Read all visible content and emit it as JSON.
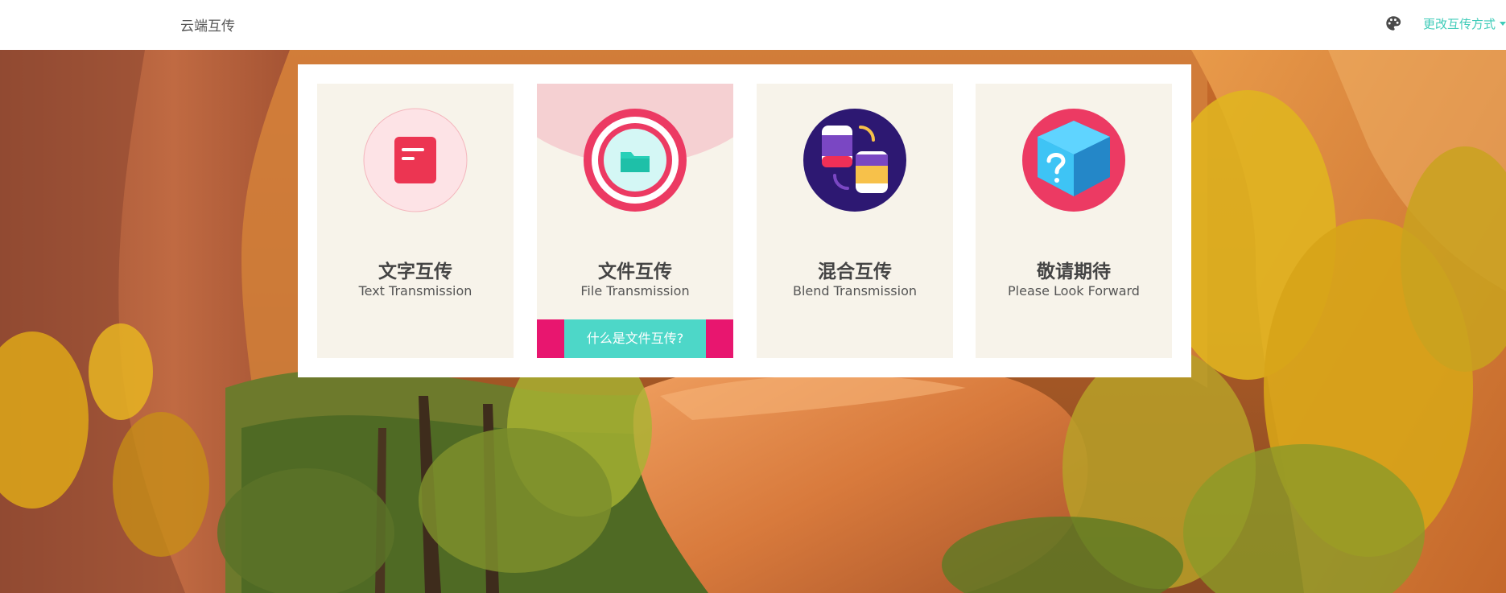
{
  "navbar": {
    "brand": "云端互传",
    "palette_icon": "palette-icon",
    "switch_label": "更改互传方式"
  },
  "cards": [
    {
      "title": "文字互传",
      "subtitle": "Text Transmission",
      "icon": "document-icon"
    },
    {
      "title": "文件互传",
      "subtitle": "File Transmission",
      "icon": "folder-icon",
      "button_label": "什么是文件互传?"
    },
    {
      "title": "混合互传",
      "subtitle": "Blend Transmission",
      "icon": "blend-icon"
    },
    {
      "title": "敬请期待",
      "subtitle": "Please Look Forward",
      "icon": "mystery-box-icon"
    }
  ],
  "colors": {
    "accent": "#3ecbb8",
    "card_bg": "#f7f3ea",
    "pink": "#e8166f",
    "teal_button": "#4dd7c8"
  }
}
